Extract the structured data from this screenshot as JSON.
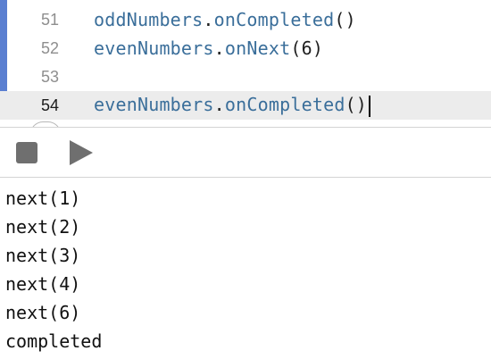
{
  "editor": {
    "lines": [
      {
        "number": "51",
        "object": "oddNumbers",
        "dot": ".",
        "method": "onCompleted",
        "args": "()"
      },
      {
        "number": "52",
        "object": "evenNumbers",
        "dot": ".",
        "method": "onNext",
        "args": "(6)"
      },
      {
        "number": "53",
        "object": "",
        "dot": "",
        "method": "",
        "args": ""
      },
      {
        "number": "54",
        "object": "evenNumbers",
        "dot": ".",
        "method": "onCompleted",
        "args": "()"
      }
    ]
  },
  "toolbar": {
    "stop_icon": "stop-icon",
    "play_icon": "play-icon"
  },
  "console": {
    "output": [
      "next(1)",
      "next(2)",
      "next(3)",
      "next(4)",
      "next(6)",
      "completed"
    ]
  },
  "colors": {
    "gutter_bar": "#5a7fd1",
    "identifier": "#3a6e9a",
    "current_line_bg": "#ececec"
  }
}
